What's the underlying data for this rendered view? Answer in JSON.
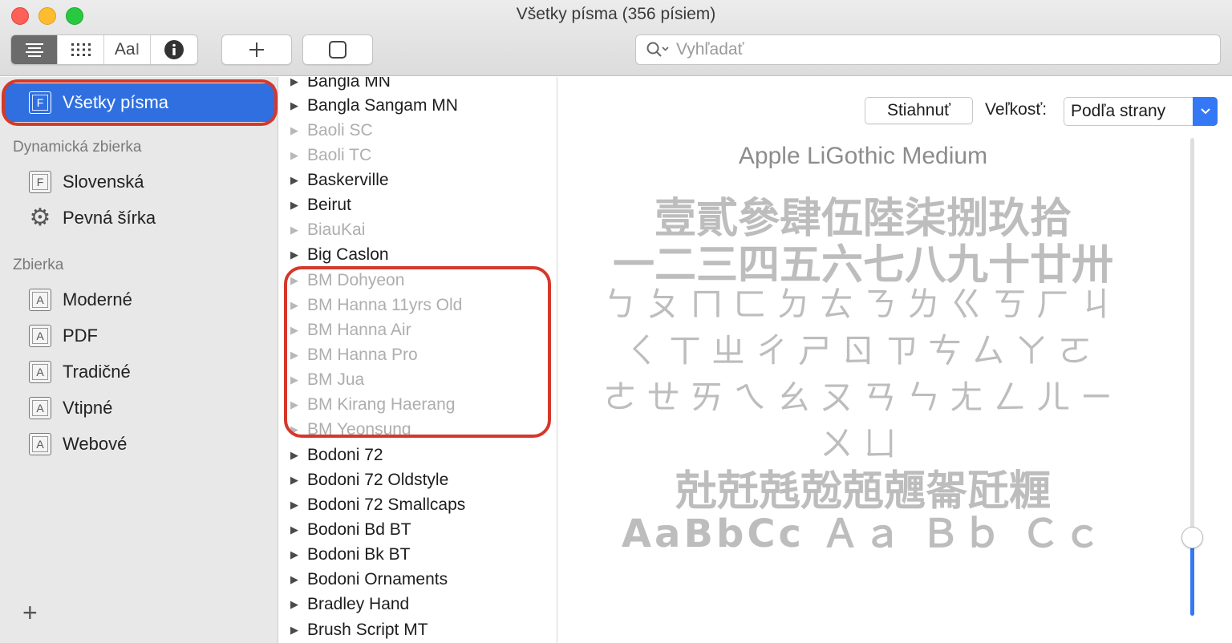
{
  "window": {
    "title": "Všetky písma (356 písiem)"
  },
  "toolbar": {
    "view_mode_icons": [
      "list-view-icon",
      "grid-view-icon",
      "sample-text-icon",
      "info-icon"
    ],
    "sample_text_label": "Aa",
    "add_icon": "plus-icon",
    "preview_toggle_icon": "square-icon",
    "search": {
      "placeholder": "Vyhľadať",
      "value": ""
    }
  },
  "sidebar": {
    "selected": {
      "label": "Všetky písma",
      "icon_letter": "F"
    },
    "sections": [
      {
        "title": "Dynamická zbierka",
        "items": [
          {
            "label": "Slovenská",
            "icon": "font-collection-icon",
            "icon_letter": "F"
          },
          {
            "label": "Pevná šírka",
            "icon": "gear-icon"
          }
        ]
      },
      {
        "title": "Zbierka",
        "items": [
          {
            "label": "Moderné",
            "icon_letter": "A"
          },
          {
            "label": "PDF",
            "icon_letter": "A"
          },
          {
            "label": "Tradičné",
            "icon_letter": "A"
          },
          {
            "label": "Vtipné",
            "icon_letter": "A"
          },
          {
            "label": "Webové",
            "icon_letter": "A"
          }
        ]
      }
    ],
    "add_label": "+",
    "highlight_color": "#d5382b",
    "selection_color": "#2f6fe0"
  },
  "font_list": {
    "items": [
      {
        "name": "Bangla MN",
        "installed": true
      },
      {
        "name": "Bangla Sangam MN",
        "installed": true
      },
      {
        "name": "Baoli SC",
        "installed": false
      },
      {
        "name": "Baoli TC",
        "installed": false
      },
      {
        "name": "Baskerville",
        "installed": true
      },
      {
        "name": "Beirut",
        "installed": true
      },
      {
        "name": "BiauKai",
        "installed": false
      },
      {
        "name": "Big Caslon",
        "installed": true
      },
      {
        "name": "BM Dohyeon",
        "installed": false
      },
      {
        "name": "BM Hanna 11yrs Old",
        "installed": false
      },
      {
        "name": "BM Hanna Air",
        "installed": false
      },
      {
        "name": "BM Hanna Pro",
        "installed": false
      },
      {
        "name": "BM Jua",
        "installed": false
      },
      {
        "name": "BM Kirang Haerang",
        "installed": false
      },
      {
        "name": "BM Yeonsung",
        "installed": false
      },
      {
        "name": "Bodoni 72",
        "installed": true
      },
      {
        "name": "Bodoni 72 Oldstyle",
        "installed": true
      },
      {
        "name": "Bodoni 72 Smallcaps",
        "installed": true
      },
      {
        "name": "Bodoni Bd BT",
        "installed": true
      },
      {
        "name": "Bodoni Bk BT",
        "installed": true
      },
      {
        "name": "Bodoni Ornaments",
        "installed": true
      },
      {
        "name": "Bradley Hand",
        "installed": true
      },
      {
        "name": "Brush Script MT",
        "installed": true
      }
    ]
  },
  "preview": {
    "download_label": "Stiahnuť",
    "size_label": "Veľkosť:",
    "size_value": "Podľa strany",
    "font_name": "Apple LiGothic Medium",
    "sample_lines": [
      "壹貳參肆伍陸柒捌玖拾",
      "一二三四五六七八九十廿卅",
      "ㄅㄆㄇㄈㄉㄊㄋㄌㄍㄎㄏㄐ",
      "ㄑㄒㄓㄔㄕㄖㄗㄘㄙㄚㄛ",
      "ㄜㄝㄞㄟㄠㄡㄢㄣㄤㄥㄦㄧ",
      "ㄨㄩ",
      "兙兛兞兝兡兣嗧瓩糎",
      "AaBbCc Ａａ Ｂｂ Ｃｃ"
    ],
    "slider_level": 0.16,
    "accent_color": "#3478f6"
  }
}
